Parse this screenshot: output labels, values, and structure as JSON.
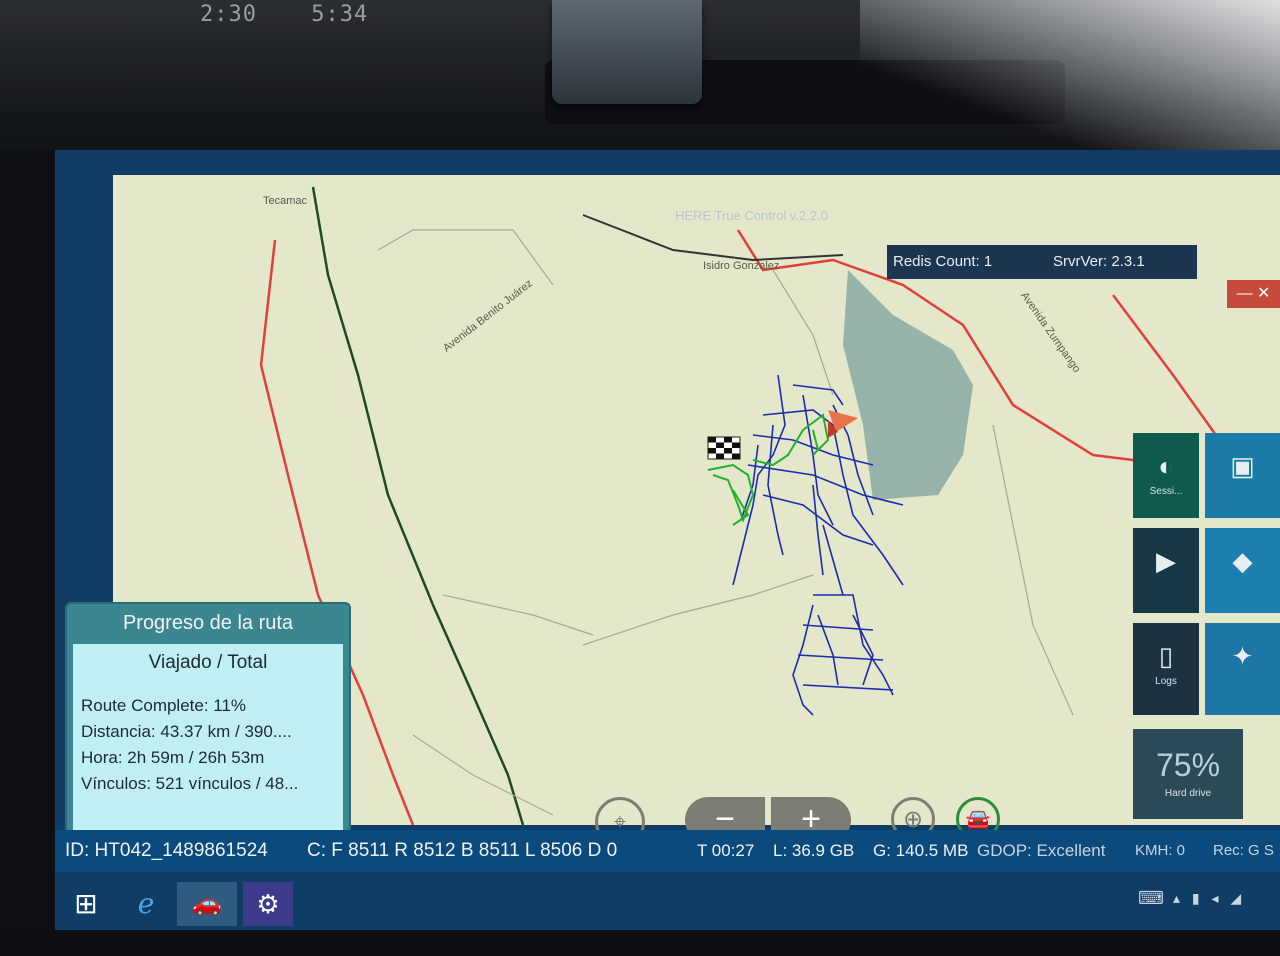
{
  "device": {
    "dash_time_1": "2:30",
    "dash_time_2": "5:34"
  },
  "app": {
    "title": "HERE True Control v.2.2.0"
  },
  "map": {
    "labels": {
      "tecamac": "Tecamac",
      "isidro": "Isidro Gonzalez",
      "benito": "Avenida Benito Juárez",
      "zumpango": "Avenida Zumpango"
    }
  },
  "status": {
    "redis_count": "Redis Count: 1",
    "srvr_ver": "SrvrVer: 2.3.1"
  },
  "window_controls": {
    "close_label": "— ✕"
  },
  "tiles": [
    {
      "label": "Sessi...",
      "icon": "session-icon"
    },
    {
      "label": "",
      "icon": "camera-icon"
    },
    {
      "label": "",
      "icon": "play-icon"
    },
    {
      "label": "",
      "icon": "diamond-icon"
    },
    {
      "label": "Logs",
      "icon": "document-icon"
    },
    {
      "label": "",
      "icon": "satellite-icon"
    },
    {
      "label": "Hard drive",
      "value": "75%"
    }
  ],
  "route_progress": {
    "title": "Progreso de la ruta",
    "subtitle": "Viajado / Total",
    "route_complete": "Route Complete: 11%",
    "distancia": "Distancia: 43.37 km / 390....",
    "hora": "Hora: 2h 59m / 26h 53m",
    "vinculos": "Vínculos: 521 vínculos / 48..."
  },
  "controls": {
    "zoom_out": "−",
    "zoom_in": "+"
  },
  "infobar": {
    "id": "ID: HT042_1489861524",
    "c": "C: F 8511 R 8512 B 8511 L 8506 D 0",
    "t": "T 00:27",
    "l": "L:  36.9 GB",
    "g": "G: 140.5 MB",
    "gdop": "GDOP: Excellent",
    "kmh": "KMH: 0",
    "rec": "Rec: G S"
  },
  "colors": {
    "map_bg": "#e4e7c9",
    "route_blue": "#1a2db0",
    "route_green": "#22b22a",
    "road_red": "#e0403a",
    "road_dark": "#1e4a25",
    "taskbar": "#0f3d66"
  }
}
